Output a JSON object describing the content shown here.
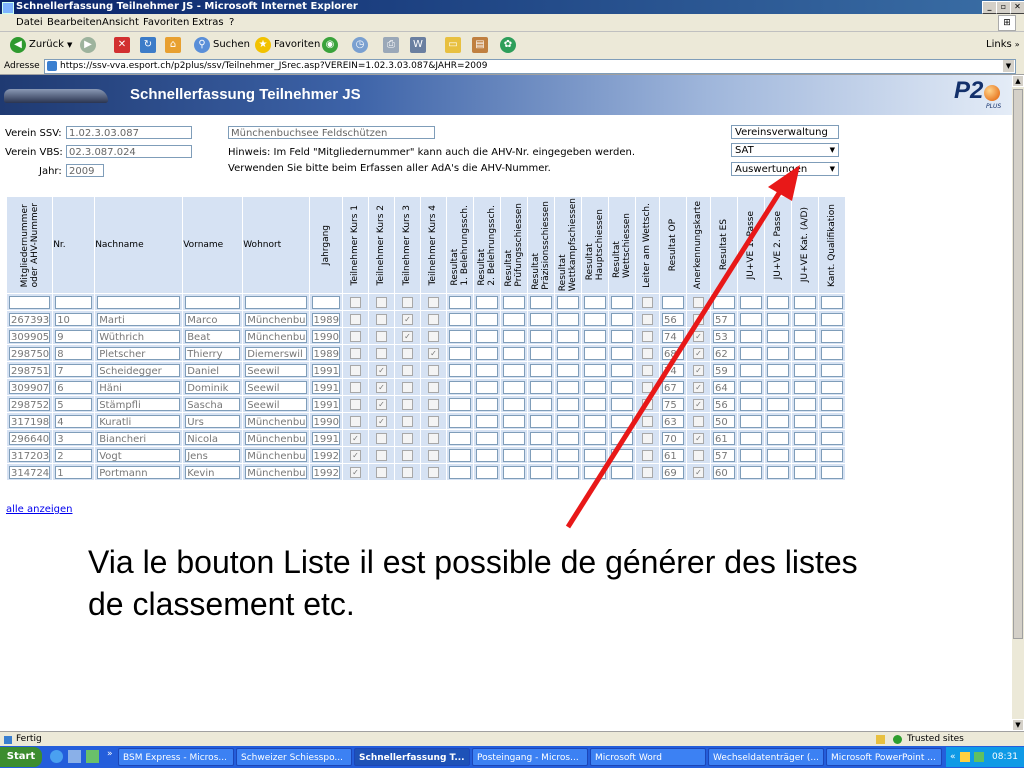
{
  "window": {
    "title": "Schnellerfassung Teilnehmer JS - Microsoft Internet Explorer"
  },
  "menu": [
    "Datei",
    "Bearbeiten",
    "Ansicht",
    "Favoriten",
    "Extras",
    "?"
  ],
  "toolbar": {
    "back": "Zurück",
    "search": "Suchen",
    "favorites": "Favoriten",
    "links": "Links"
  },
  "address": {
    "label": "Adresse",
    "url": "https://ssv-vva.esport.ch/p2plus/ssv/Teilnehmer_JSrec.asp?VEREIN=1.02.3.03.087&JAHR=2009"
  },
  "page": {
    "title": "Schnellerfassung Teilnehmer JS",
    "logo": "P2"
  },
  "form": {
    "verein_ssv_label": "Verein SSV:",
    "verein_ssv": "1.02.3.03.087",
    "verein_vbs_label": "Verein VBS:",
    "verein_vbs": "02.3.087.024",
    "jahr_label": "Jahr:",
    "jahr": "2009",
    "club_name": "Münchenbuchsee Feldschützen",
    "hint1": "Hinweis: Im Feld \"Mitgliedernummer\" kann auch die AHV-Nr. eingegeben werden.",
    "hint2": "Verwenden Sie bitte beim Erfassen aller AdA's die AHV-Nummer.",
    "btn_vereinsverwaltung": "Vereinsverwaltung",
    "select_sat": "SAT",
    "select_auswertungen": "Auswertungen"
  },
  "grid": {
    "headers": [
      "Mitgliedernummer\noder AHV-Nummer",
      "Nr.",
      "Nachname",
      "Vorname",
      "Wohnort",
      "Jahrgang",
      "Teilnehmer Kurs 1",
      "Teilnehmer Kurs 2",
      "Teilnehmer Kurs 3",
      "Teilnehmer Kurs 4",
      "Resultat\n1. Belehrungssch.",
      "Resultat\n2. Belehrungssch.",
      "Resultat\nPrüfungsschiessen",
      "Resultat\nPräzisionsschiessen",
      "Resultat\nWettkampfschiessen",
      "Resultat\nHauptschiessen",
      "Resultat\nWettschiessen",
      "Leiter am Wettsch.",
      "Resultat OP",
      "Anerkennungskarte",
      "Resultat ES",
      "JU+VE 1. Passe",
      "JU+VE 2. Passe",
      "JU+VE Kat. (A/D)",
      "Kant. Qualifikation"
    ],
    "rows": [
      {
        "id": "267393",
        "nr": "10",
        "name": "Marti",
        "vorname": "Marco",
        "ort": "Münchenbu",
        "jg": "1989",
        "k": [
          false,
          false,
          true,
          false
        ],
        "lw": false,
        "op": "56",
        "ak": false,
        "es": "57"
      },
      {
        "id": "309905",
        "nr": "9",
        "name": "Wüthrich",
        "vorname": "Beat",
        "ort": "Münchenbu",
        "jg": "1990",
        "k": [
          false,
          false,
          true,
          false
        ],
        "lw": false,
        "op": "74",
        "ak": true,
        "es": "53"
      },
      {
        "id": "298750",
        "nr": "8",
        "name": "Pletscher",
        "vorname": "Thierry",
        "ort": "Diemerswil",
        "jg": "1989",
        "k": [
          false,
          false,
          false,
          true
        ],
        "lw": false,
        "op": "68",
        "ak": true,
        "es": "62"
      },
      {
        "id": "298751",
        "nr": "7",
        "name": "Scheidegger",
        "vorname": "Daniel",
        "ort": "Seewil",
        "jg": "1991",
        "k": [
          false,
          true,
          false,
          false
        ],
        "lw": false,
        "op": "74",
        "ak": true,
        "es": "59"
      },
      {
        "id": "309907",
        "nr": "6",
        "name": "Häni",
        "vorname": "Dominik",
        "ort": "Seewil",
        "jg": "1991",
        "k": [
          false,
          true,
          false,
          false
        ],
        "lw": false,
        "op": "67",
        "ak": true,
        "es": "64"
      },
      {
        "id": "298752",
        "nr": "5",
        "name": "Stämpfli",
        "vorname": "Sascha",
        "ort": "Seewil",
        "jg": "1991",
        "k": [
          false,
          true,
          false,
          false
        ],
        "lw": false,
        "op": "75",
        "ak": true,
        "es": "56"
      },
      {
        "id": "317198",
        "nr": "4",
        "name": "Kuratli",
        "vorname": "Urs",
        "ort": "Münchenbu",
        "jg": "1990",
        "k": [
          false,
          true,
          false,
          false
        ],
        "lw": false,
        "op": "63",
        "ak": false,
        "es": "50"
      },
      {
        "id": "296640",
        "nr": "3",
        "name": "Biancheri",
        "vorname": "Nicola",
        "ort": "Münchenbu",
        "jg": "1991",
        "k": [
          true,
          false,
          false,
          false
        ],
        "lw": false,
        "op": "70",
        "ak": true,
        "es": "61"
      },
      {
        "id": "317203",
        "nr": "2",
        "name": "Vogt",
        "vorname": "Jens",
        "ort": "Münchenbu",
        "jg": "1992",
        "k": [
          true,
          false,
          false,
          false
        ],
        "lw": false,
        "op": "61",
        "ak": false,
        "es": "57"
      },
      {
        "id": "314724",
        "nr": "1",
        "name": "Portmann",
        "vorname": "Kevin",
        "ort": "Münchenbu",
        "jg": "1992",
        "k": [
          true,
          false,
          false,
          false
        ],
        "lw": false,
        "op": "69",
        "ak": true,
        "es": "60"
      }
    ],
    "show_all": "alle anzeigen"
  },
  "caption": "Via le bouton Liste il est possible de générer des listes de classement etc.",
  "status": {
    "text": "Fertig",
    "zone": "Trusted sites"
  },
  "taskbar": {
    "start": "Start",
    "tasks": [
      "BSM Express - Micros...",
      "Schweizer Schiesspo...",
      "Schnellerfassung T...",
      "Posteingang - Micros...",
      "Microsoft Word",
      "Wechseldatenträger (...",
      "Microsoft PowerPoint ..."
    ],
    "clock": "08:31"
  },
  "colors": {
    "arrow": "#e81818",
    "grid_bg": "#d6e2f3"
  }
}
